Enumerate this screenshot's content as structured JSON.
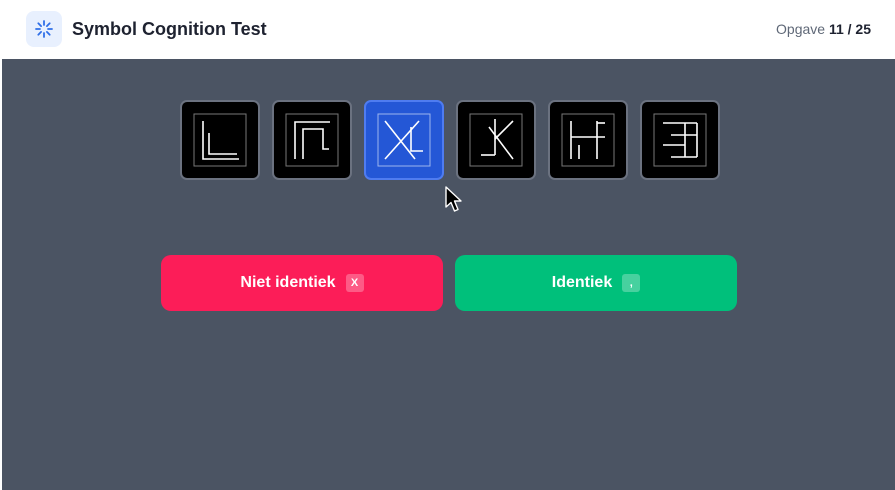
{
  "header": {
    "title": "Symbol Cognition Test",
    "progress_label": "Opgave",
    "progress_value": "11 / 25",
    "logo_icon": "loader-icon",
    "accent": "#2457d6"
  },
  "symbols": [
    {
      "icon": "symbol-glyph-1-icon",
      "selected": false
    },
    {
      "icon": "symbol-glyph-2-icon",
      "selected": false
    },
    {
      "icon": "symbol-glyph-3-icon",
      "selected": true
    },
    {
      "icon": "symbol-glyph-4-icon",
      "selected": false
    },
    {
      "icon": "symbol-glyph-5-icon",
      "selected": false
    },
    {
      "icon": "symbol-glyph-6-icon",
      "selected": false
    }
  ],
  "buttons": {
    "not_identical": {
      "label": "Niet identiek",
      "key": "X",
      "color": "#fc1d58"
    },
    "identical": {
      "label": "Identiek",
      "key": ",",
      "color": "#00c07b"
    }
  }
}
